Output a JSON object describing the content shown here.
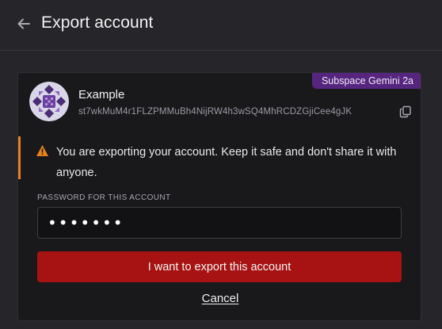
{
  "header": {
    "title": "Export account",
    "back_icon": "arrow-left-icon"
  },
  "account": {
    "name": "Example",
    "address": "st7wkMuM4r1FLZPMMuBh4NijRW4h3wSQ4MhRCDZGjiCee4gJK",
    "network": "Subspace Gemini 2a",
    "copy_icon": "copy-icon",
    "avatar_icon": "identicon-avatar"
  },
  "warning": {
    "icon": "warning-triangle-icon",
    "text": "You are exporting your account. Keep it safe and don't share it with anyone."
  },
  "password": {
    "label": "PASSWORD FOR THIS ACCOUNT",
    "value": "•••••••"
  },
  "actions": {
    "export_label": "I want to export this account",
    "cancel_label": "Cancel"
  },
  "colors": {
    "background": "#26262a",
    "card": "#19191c",
    "badge": "#56267f",
    "warning_accent": "#e8821e",
    "export_button": "#a71313"
  }
}
